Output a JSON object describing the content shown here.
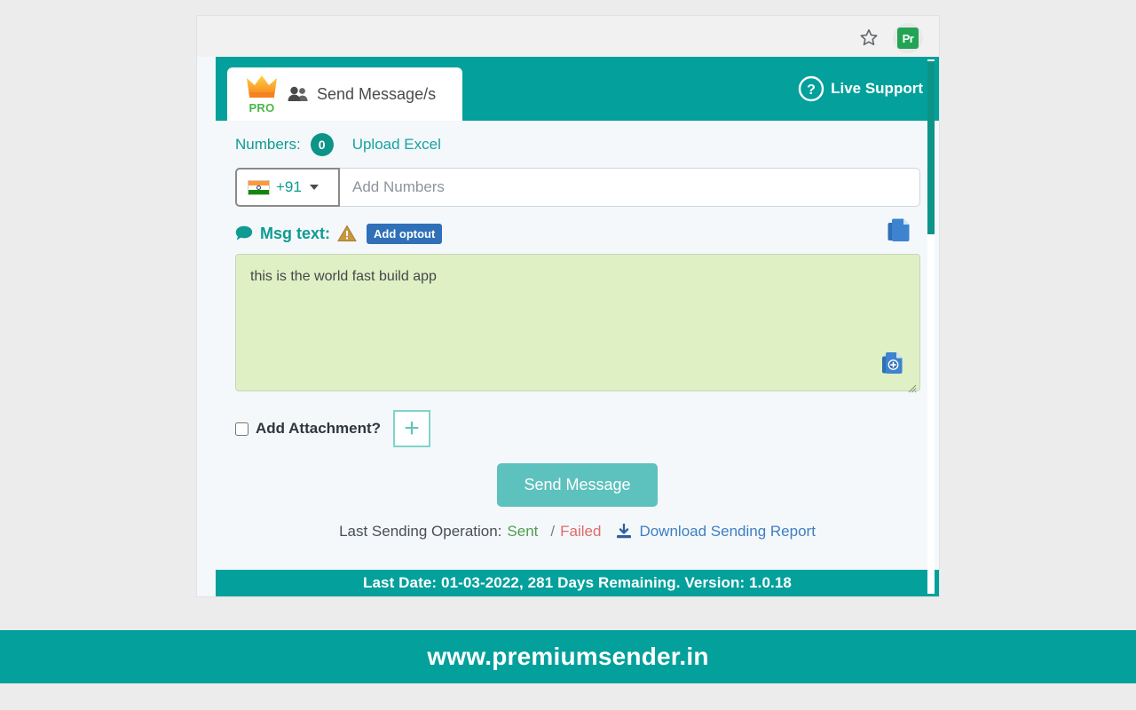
{
  "browser": {
    "bookmark_icon": "star-icon",
    "extension_badge_label": "Pr"
  },
  "app": {
    "tab": {
      "pro_label": "PRO",
      "crown_icon": "crown-icon",
      "contacts_icon": "users-icon",
      "label": "Send Message/s"
    },
    "live_support": {
      "icon": "question-circle-icon",
      "label": "Live Support"
    },
    "numbers": {
      "label": "Numbers:",
      "count": "0",
      "upload_excel_label": "Upload Excel"
    },
    "number_input": {
      "flag_icon": "india-flag-icon",
      "dial_code": "+91",
      "dropdown_icon": "chevron-down-icon",
      "placeholder": "Add Numbers",
      "value": ""
    },
    "message": {
      "chat_icon": "chat-bubble-icon",
      "label": "Msg text:",
      "warning_icon": "warning-triangle-icon",
      "optout_label": "Add optout",
      "copy_icon": "copy-documents-icon",
      "insert_icon": "copy-add-icon",
      "resize_icon": "resize-grip-icon",
      "value": "this is the world fast build app",
      "placeholder": ""
    },
    "attachment": {
      "label": "Add Attachment?",
      "checked": false,
      "add_icon": "plus-icon"
    },
    "send_button_label": "Send Message",
    "status": {
      "prefix": "Last Sending Operation:",
      "sent_label": "Sent",
      "separator": "/",
      "failed_label": "Failed",
      "download_icon": "download-icon",
      "download_label": "Download Sending Report"
    },
    "footer_text": "Last Date: 01-03-2022, 281 Days Remaining. Version: 1.0.18"
  },
  "site_banner": "www.premiumsender.in",
  "colors": {
    "brand_teal": "#04a09b",
    "accent_teal": "#0d9488",
    "send_button": "#5dc1bd",
    "textarea_green": "#dff0c4",
    "optout_blue": "#2f70b8",
    "sent_green": "#4f9e4f",
    "failed_red": "#e06a6a",
    "link_blue": "#3d7fc1",
    "pro_green": "#49b649"
  }
}
